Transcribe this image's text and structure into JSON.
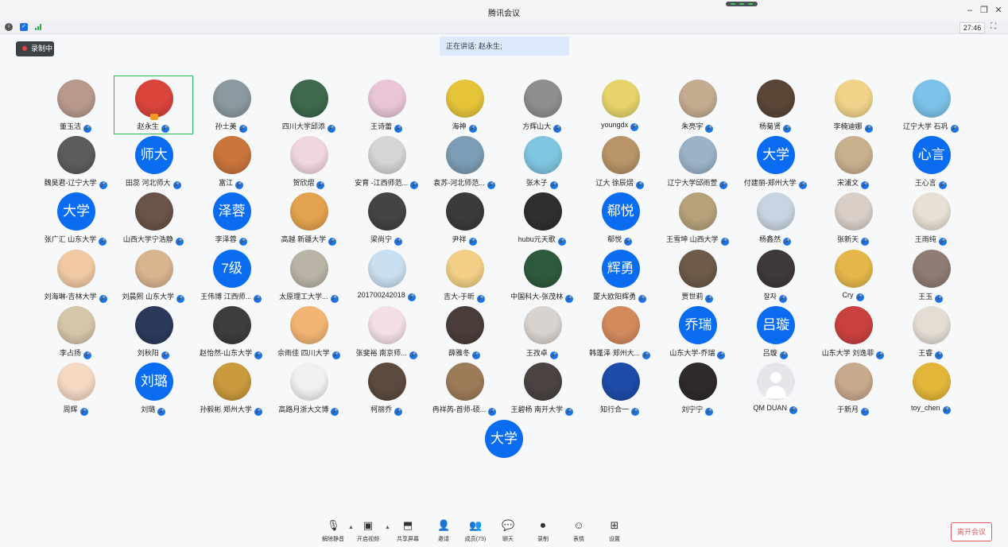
{
  "window": {
    "title": "腾讯会议"
  },
  "infobar": {
    "time": "27:46",
    "fullscreen_icon": "fullscreen-icon"
  },
  "recording_badge": "录制中",
  "speaking_banner": "正在讲话: 赵永生;",
  "participants": [
    {
      "name": "董玉洁",
      "avatar": "photo",
      "color": "#b79a8c"
    },
    {
      "name": "赵永生",
      "avatar": "photo",
      "color": "#d9443b",
      "selected": true,
      "speaking": true
    },
    {
      "name": "孙士美",
      "avatar": "photo",
      "color": "#8b9aa0"
    },
    {
      "name": "四川大学邱添",
      "avatar": "photo",
      "color": "#3c6a4a"
    },
    {
      "name": "王诗蕾",
      "avatar": "photo",
      "color": "#e9c6d6"
    },
    {
      "name": "海神",
      "avatar": "photo",
      "color": "#e6c43a"
    },
    {
      "name": "方辉山大",
      "avatar": "photo",
      "color": "#8e8e8e"
    },
    {
      "name": "youngdx",
      "avatar": "photo",
      "color": "#e7d36b"
    },
    {
      "name": "朱亮宇",
      "avatar": "photo",
      "color": "#c4ac90"
    },
    {
      "name": "杨菊贤",
      "avatar": "photo",
      "color": "#5a4537"
    },
    {
      "name": "李楠迪娜",
      "avatar": "photo",
      "color": "#f1d38a"
    },
    {
      "name": "辽宁大学 石巩",
      "avatar": "photo",
      "color": "#7cc2e8"
    },
    {
      "name": "魏昊君-辽宁大学",
      "avatar": "photo",
      "color": "#5c5c5c"
    },
    {
      "name": "田蕊 河北师大",
      "avatar": "text",
      "text": "师大"
    },
    {
      "name": "富江",
      "avatar": "photo",
      "color": "#c9743b"
    },
    {
      "name": "贺欣熠",
      "avatar": "photo",
      "color": "#f0d7dd"
    },
    {
      "name": "安育 -江西师范...",
      "avatar": "photo",
      "color": "#d5d5d5"
    },
    {
      "name": "袁苏-河北师范...",
      "avatar": "photo",
      "color": "#7c9db5"
    },
    {
      "name": "张木子",
      "avatar": "photo",
      "color": "#7fc5e0"
    },
    {
      "name": "辽大 徐辰熠",
      "avatar": "photo",
      "color": "#b89468"
    },
    {
      "name": "辽宁大学邱雨萱",
      "avatar": "photo",
      "color": "#9ab3c9"
    },
    {
      "name": "付建丽-郑州大学",
      "avatar": "text",
      "text": "大学"
    },
    {
      "name": "宋浦文",
      "avatar": "photo",
      "color": "#c8b08d"
    },
    {
      "name": "王心言",
      "avatar": "text",
      "text": "心言"
    },
    {
      "name": "张广汇 山东大学",
      "avatar": "text",
      "text": "大学"
    },
    {
      "name": "山西大学宁浩静",
      "avatar": "photo",
      "color": "#6b5347"
    },
    {
      "name": "李泽蓉",
      "avatar": "text",
      "text": "泽蓉"
    },
    {
      "name": "高越 新疆大学",
      "avatar": "photo",
      "color": "#e3a24d"
    },
    {
      "name": "梁尚宁",
      "avatar": "photo",
      "color": "#444444"
    },
    {
      "name": "尹祥",
      "avatar": "photo",
      "color": "#3b3b3b"
    },
    {
      "name": "hubu元天歌",
      "avatar": "photo",
      "color": "#2f2f2f"
    },
    {
      "name": "郗悦",
      "avatar": "text",
      "text": "郗悦"
    },
    {
      "name": "王雪坤 山西大学",
      "avatar": "photo",
      "color": "#b6a17a"
    },
    {
      "name": "杨鑫然",
      "avatar": "photo",
      "color": "#c8d4e2"
    },
    {
      "name": "张新天",
      "avatar": "photo",
      "color": "#d9cfc7"
    },
    {
      "name": "王雨纯",
      "avatar": "photo",
      "color": "#e8e0d4"
    },
    {
      "name": "刘海琳-吉林大学",
      "avatar": "photo",
      "color": "#f0c9a4"
    },
    {
      "name": "刘晨熙 山东大学",
      "avatar": "photo",
      "color": "#d8b48f"
    },
    {
      "name": "王伟博 江西师...",
      "avatar": "text",
      "text": "7级"
    },
    {
      "name": "太原理工大学...",
      "avatar": "photo",
      "color": "#b9b4a5"
    },
    {
      "name": "201700242018",
      "avatar": "photo",
      "color": "#c9dff0"
    },
    {
      "name": "吉大-于昕",
      "avatar": "photo",
      "color": "#f1cf86"
    },
    {
      "name": "中国科大-张茂林",
      "avatar": "photo",
      "color": "#2e5a3c"
    },
    {
      "name": "厦大欧阳辉勇",
      "avatar": "text",
      "text": "辉勇"
    },
    {
      "name": "贾世莉",
      "avatar": "photo",
      "color": "#6d5a48"
    },
    {
      "name": "잘자",
      "avatar": "photo",
      "color": "#3f3a39"
    },
    {
      "name": "Cry",
      "avatar": "photo",
      "color": "#e4b74a"
    },
    {
      "name": "王玉",
      "avatar": "photo",
      "color": "#8f7c72"
    },
    {
      "name": "李占扬",
      "avatar": "photo",
      "color": "#d5c6a9"
    },
    {
      "name": "刘秋阳",
      "avatar": "photo",
      "color": "#2b3a5c"
    },
    {
      "name": "赵怡然-山东大学",
      "avatar": "photo",
      "color": "#3d3d3d"
    },
    {
      "name": "佘雨佳 四川大学",
      "avatar": "photo",
      "color": "#f2b473"
    },
    {
      "name": "张斐裕 南京师...",
      "avatar": "photo",
      "color": "#f3dfe4"
    },
    {
      "name": "薛雅冬",
      "avatar": "photo",
      "color": "#4b3d3a"
    },
    {
      "name": "王孜卓",
      "avatar": "photo",
      "color": "#d9d3cf"
    },
    {
      "name": "韩蓬泽 郑州大...",
      "avatar": "photo",
      "color": "#d28a5d"
    },
    {
      "name": "山东大学-乔瑞",
      "avatar": "text",
      "text": "乔瑞"
    },
    {
      "name": "吕璇",
      "avatar": "text",
      "text": "吕璇"
    },
    {
      "name": "山东大学 刘逸菲",
      "avatar": "photo",
      "color": "#c9413f"
    },
    {
      "name": "王睿",
      "avatar": "photo",
      "color": "#e3ddd3"
    },
    {
      "name": "周辉",
      "avatar": "photo",
      "color": "#f4d8c2"
    },
    {
      "name": "刘璐",
      "avatar": "text",
      "text": "刘璐"
    },
    {
      "name": "孙毅彬 郑州大学",
      "avatar": "photo",
      "color": "#c99a3e"
    },
    {
      "name": "高路月浙大文博",
      "avatar": "photo",
      "color": "#f2f0ee"
    },
    {
      "name": "柯丽乔",
      "avatar": "photo",
      "color": "#5b4a3e"
    },
    {
      "name": "冉祥芮-首师-硕...",
      "avatar": "photo",
      "color": "#9c7b58"
    },
    {
      "name": "王碧杨 南开大学",
      "avatar": "photo",
      "color": "#4a4342"
    },
    {
      "name": "知行合一",
      "avatar": "photo",
      "color": "#1e4aa8"
    },
    {
      "name": "刘宁宁",
      "avatar": "photo",
      "color": "#2f2a2a"
    },
    {
      "name": "QM DUAN",
      "avatar": "gray"
    },
    {
      "name": "于新月",
      "avatar": "photo",
      "color": "#c7a98b"
    },
    {
      "name": "toy_chen",
      "avatar": "photo",
      "color": "#e3b63a"
    }
  ],
  "extra_participant": {
    "avatar_text": "大学"
  },
  "toolbar": {
    "unmute": "解除静音",
    "video": "开启视频",
    "share": "共享屏幕",
    "invite": "邀请",
    "members": "成员(73)",
    "chat": "聊天",
    "record": "录制",
    "reaction": "表情",
    "settings": "设置",
    "leave": "离开会议"
  },
  "icons": {
    "info": "info-icon",
    "shield": "shield-icon",
    "signal": "signal-icon",
    "mic": "mic-muted-icon",
    "video": "video-off-icon",
    "share": "share-screen-icon",
    "invite": "invite-icon",
    "members": "members-icon",
    "chat": "chat-icon",
    "record": "record-icon",
    "reaction": "emoji-icon",
    "settings": "settings-icon"
  },
  "colors": {
    "accent": "#0a6cf0",
    "mic": "#1a73e8",
    "leave": "#e25b5b",
    "selected": "#2db55d"
  }
}
